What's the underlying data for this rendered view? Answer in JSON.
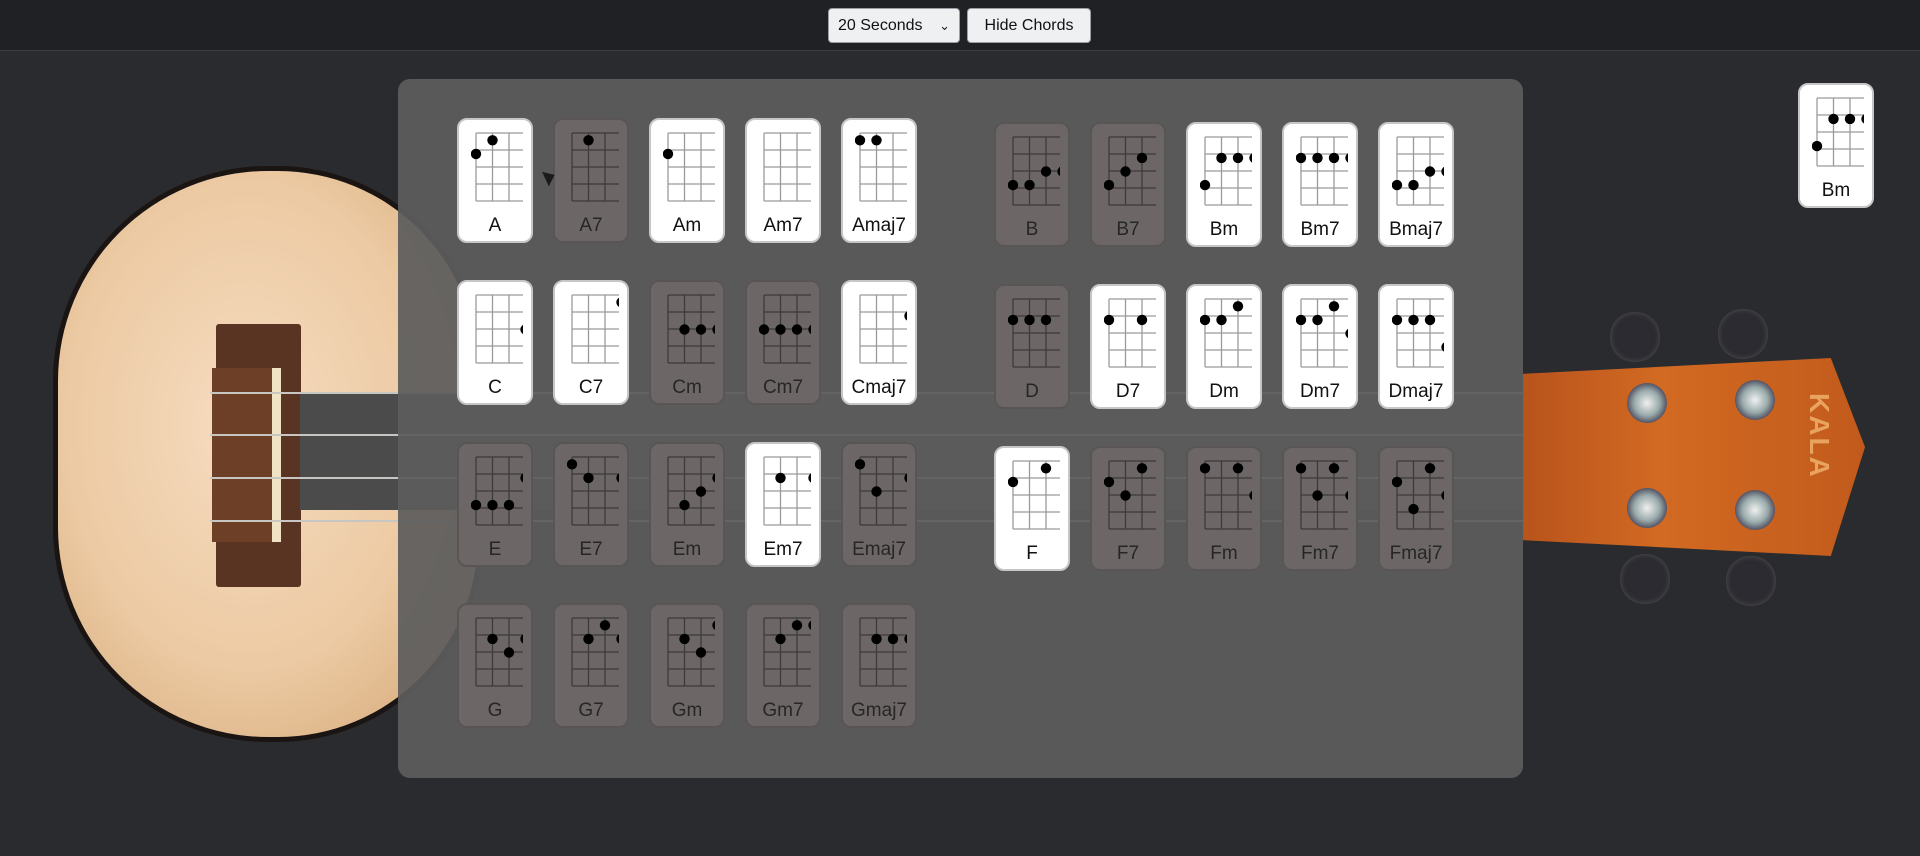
{
  "toolbar": {
    "timer_selected": "20 Seconds",
    "hide_chords_label": "Hide Chords"
  },
  "current_chord": {
    "name": "Bm",
    "dots": [
      [
        4,
        0
      ],
      [
        2,
        1
      ],
      [
        2,
        2
      ],
      [
        2,
        3
      ]
    ]
  },
  "chords": [
    {
      "name": "A",
      "active": true,
      "dots": [
        [
          2,
          0
        ],
        [
          1,
          1
        ]
      ]
    },
    {
      "name": "A7",
      "active": false,
      "dots": [
        [
          1,
          1
        ]
      ]
    },
    {
      "name": "Am",
      "active": true,
      "dots": [
        [
          2,
          0
        ]
      ]
    },
    {
      "name": "Am7",
      "active": true,
      "dots": []
    },
    {
      "name": "Amaj7",
      "active": true,
      "dots": [
        [
          1,
          0
        ],
        [
          1,
          1
        ]
      ]
    },
    {
      "name": "B",
      "active": false,
      "dots": [
        [
          4,
          0
        ],
        [
          4,
          1
        ],
        [
          3,
          2
        ],
        [
          3,
          3
        ]
      ]
    },
    {
      "name": "B7",
      "active": false,
      "dots": [
        [
          4,
          0
        ],
        [
          3,
          1
        ],
        [
          2,
          2
        ]
      ]
    },
    {
      "name": "Bm",
      "active": true,
      "dots": [
        [
          4,
          0
        ],
        [
          2,
          1
        ],
        [
          2,
          2
        ],
        [
          2,
          3
        ]
      ]
    },
    {
      "name": "Bm7",
      "active": true,
      "dots": [
        [
          2,
          0
        ],
        [
          2,
          1
        ],
        [
          2,
          2
        ],
        [
          2,
          3
        ]
      ]
    },
    {
      "name": "Bmaj7",
      "active": true,
      "dots": [
        [
          4,
          0
        ],
        [
          4,
          1
        ],
        [
          3,
          2
        ],
        [
          3,
          3
        ]
      ]
    },
    {
      "name": "C",
      "active": true,
      "dots": [
        [
          3,
          3
        ]
      ]
    },
    {
      "name": "C7",
      "active": true,
      "dots": [
        [
          1,
          3
        ]
      ]
    },
    {
      "name": "Cm",
      "active": false,
      "dots": [
        [
          3,
          1
        ],
        [
          3,
          2
        ],
        [
          3,
          3
        ]
      ]
    },
    {
      "name": "Cm7",
      "active": false,
      "dots": [
        [
          3,
          0
        ],
        [
          3,
          1
        ],
        [
          3,
          2
        ],
        [
          3,
          3
        ]
      ]
    },
    {
      "name": "Cmaj7",
      "active": true,
      "dots": [
        [
          2,
          3
        ]
      ]
    },
    {
      "name": "D",
      "active": false,
      "dots": [
        [
          2,
          0
        ],
        [
          2,
          1
        ],
        [
          2,
          2
        ]
      ]
    },
    {
      "name": "D7",
      "active": true,
      "dots": [
        [
          2,
          0
        ],
        [
          2,
          2
        ]
      ]
    },
    {
      "name": "Dm",
      "active": true,
      "dots": [
        [
          2,
          0
        ],
        [
          2,
          1
        ],
        [
          1,
          2
        ]
      ]
    },
    {
      "name": "Dm7",
      "active": true,
      "dots": [
        [
          2,
          0
        ],
        [
          2,
          1
        ],
        [
          1,
          2
        ],
        [
          3,
          3
        ]
      ]
    },
    {
      "name": "Dmaj7",
      "active": true,
      "dots": [
        [
          2,
          0
        ],
        [
          2,
          1
        ],
        [
          2,
          2
        ],
        [
          4,
          3
        ]
      ]
    },
    {
      "name": "E",
      "active": false,
      "dots": [
        [
          4,
          0
        ],
        [
          4,
          1
        ],
        [
          4,
          2
        ],
        [
          2,
          3
        ]
      ]
    },
    {
      "name": "E7",
      "active": false,
      "dots": [
        [
          1,
          0
        ],
        [
          2,
          1
        ],
        [
          2,
          3
        ]
      ]
    },
    {
      "name": "Em",
      "active": false,
      "dots": [
        [
          4,
          1
        ],
        [
          3,
          2
        ],
        [
          2,
          3
        ]
      ]
    },
    {
      "name": "Em7",
      "active": true,
      "dots": [
        [
          2,
          1
        ],
        [
          2,
          3
        ]
      ]
    },
    {
      "name": "Emaj7",
      "active": false,
      "dots": [
        [
          1,
          0
        ],
        [
          3,
          1
        ],
        [
          2,
          3
        ]
      ]
    },
    {
      "name": "F",
      "active": true,
      "dots": [
        [
          2,
          0
        ],
        [
          1,
          2
        ]
      ]
    },
    {
      "name": "F7",
      "active": false,
      "dots": [
        [
          2,
          0
        ],
        [
          3,
          1
        ],
        [
          1,
          2
        ]
      ]
    },
    {
      "name": "Fm",
      "active": false,
      "dots": [
        [
          1,
          0
        ],
        [
          1,
          2
        ],
        [
          3,
          3
        ]
      ]
    },
    {
      "name": "Fm7",
      "active": false,
      "dots": [
        [
          1,
          0
        ],
        [
          3,
          1
        ],
        [
          1,
          2
        ],
        [
          3,
          3
        ]
      ]
    },
    {
      "name": "Fmaj7",
      "active": false,
      "dots": [
        [
          2,
          0
        ],
        [
          4,
          1
        ],
        [
          1,
          2
        ],
        [
          3,
          3
        ]
      ]
    },
    {
      "name": "G",
      "active": false,
      "dots": [
        [
          2,
          1
        ],
        [
          3,
          2
        ],
        [
          2,
          3
        ]
      ]
    },
    {
      "name": "G7",
      "active": false,
      "dots": [
        [
          2,
          1
        ],
        [
          1,
          2
        ],
        [
          2,
          3
        ]
      ]
    },
    {
      "name": "Gm",
      "active": false,
      "dots": [
        [
          2,
          1
        ],
        [
          3,
          2
        ],
        [
          1,
          3
        ]
      ]
    },
    {
      "name": "Gm7",
      "active": false,
      "dots": [
        [
          2,
          1
        ],
        [
          1,
          2
        ],
        [
          1,
          3
        ]
      ]
    },
    {
      "name": "Gmaj7",
      "active": false,
      "dots": [
        [
          2,
          1
        ],
        [
          2,
          2
        ],
        [
          2,
          3
        ]
      ]
    }
  ],
  "brand_text": "KALA"
}
